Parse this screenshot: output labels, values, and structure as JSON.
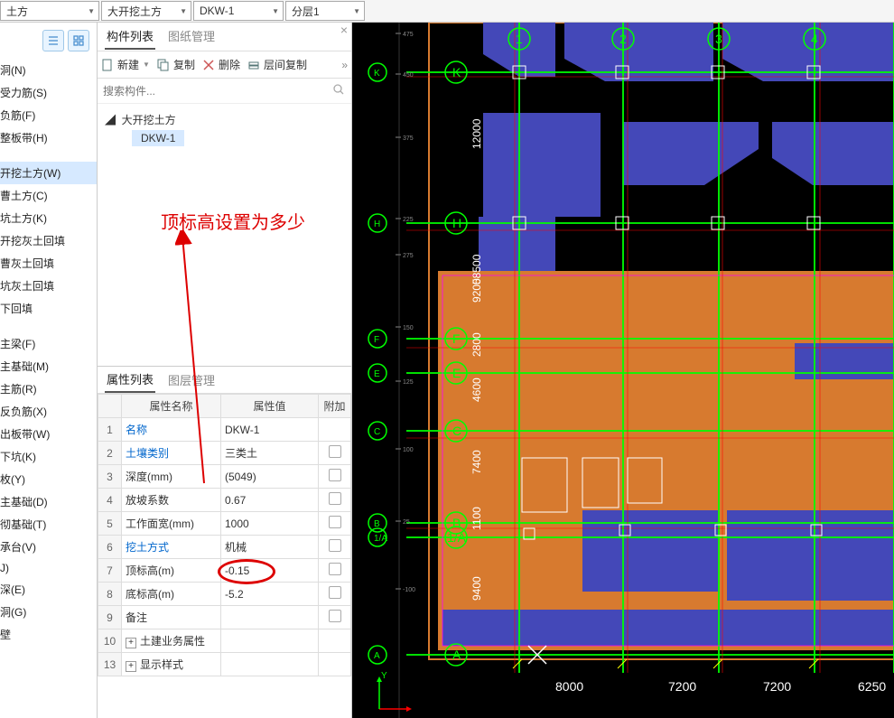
{
  "toolbar": {
    "dropdown1": "土方",
    "dropdown2": "大开挖土方",
    "dropdown3": "DKW-1",
    "dropdown4": "分层1"
  },
  "leftPanel": {
    "items": [
      "洞(N)",
      "受力筋(S)",
      "负筋(F)",
      "整板带(H)",
      "",
      "开挖土方(W)",
      "曹土方(C)",
      "坑土方(K)",
      "开挖灰土回填",
      "曹灰土回填",
      "坑灰土回填",
      "下回填",
      "",
      "主梁(F)",
      "主基础(M)",
      "主筋(R)",
      "反负筋(X)",
      "出板带(W)",
      "下坑(K)",
      "枚(Y)",
      "主基础(D)",
      "彻基础(T)",
      "承台(V)",
      "J)",
      "深(E)",
      "洞(G)",
      "壁"
    ],
    "selectedIdx": 5
  },
  "middle": {
    "tabs": {
      "list": "构件列表",
      "drawing": "图纸管理"
    },
    "toolbar": {
      "new": "新建",
      "copy": "复制",
      "delete": "删除",
      "layerCopy": "层间复制"
    },
    "searchPlaceholder": "搜索构件...",
    "tree": {
      "parent": "大开挖土方",
      "child": "DKW-1"
    },
    "annotation": "顶标高设置为多少"
  },
  "props": {
    "tabs": {
      "attrs": "属性列表",
      "layers": "图层管理"
    },
    "headers": {
      "name": "属性名称",
      "value": "属性值",
      "attach": "附加"
    },
    "rows": [
      {
        "num": "1",
        "name": "名称",
        "value": "DKW-1",
        "link": true,
        "chk": false
      },
      {
        "num": "2",
        "name": "土壤类别",
        "value": "三类土",
        "link": true,
        "chk": true
      },
      {
        "num": "3",
        "name": "深度(mm)",
        "value": "(5049)",
        "chk": true
      },
      {
        "num": "4",
        "name": "放坡系数",
        "value": "0.67",
        "chk": true
      },
      {
        "num": "5",
        "name": "工作面宽(mm)",
        "value": "1000",
        "chk": true
      },
      {
        "num": "6",
        "name": "挖土方式",
        "value": "机械",
        "link": true,
        "chk": true
      },
      {
        "num": "7",
        "name": "顶标高(m)",
        "value": "-0.15",
        "chk": true,
        "circled": true
      },
      {
        "num": "8",
        "name": "底标高(m)",
        "value": "-5.2",
        "chk": true
      },
      {
        "num": "9",
        "name": "备注",
        "value": "",
        "chk": true
      },
      {
        "num": "10",
        "name": "土建业务属性",
        "value": "",
        "exp": true
      },
      {
        "num": "13",
        "name": "显示样式",
        "value": "",
        "exp": true
      }
    ]
  },
  "cad": {
    "gridLettersV": [
      "K",
      "",
      "H",
      "F",
      "E",
      "C",
      "B",
      "1/A",
      "A"
    ],
    "gridNumbersH": [
      "1",
      "2",
      "3",
      "4"
    ],
    "dimsLeft": [
      "12000",
      "58500",
      "9200",
      "2800",
      "4600",
      "7400",
      "1100",
      "9400"
    ],
    "dimsBottom": [
      "8000",
      "7200",
      "7200",
      "6250"
    ],
    "rulerTicks": [
      "475",
      "450",
      "375",
      "225",
      "275",
      "150",
      "125",
      "100",
      "25",
      "-100"
    ]
  }
}
